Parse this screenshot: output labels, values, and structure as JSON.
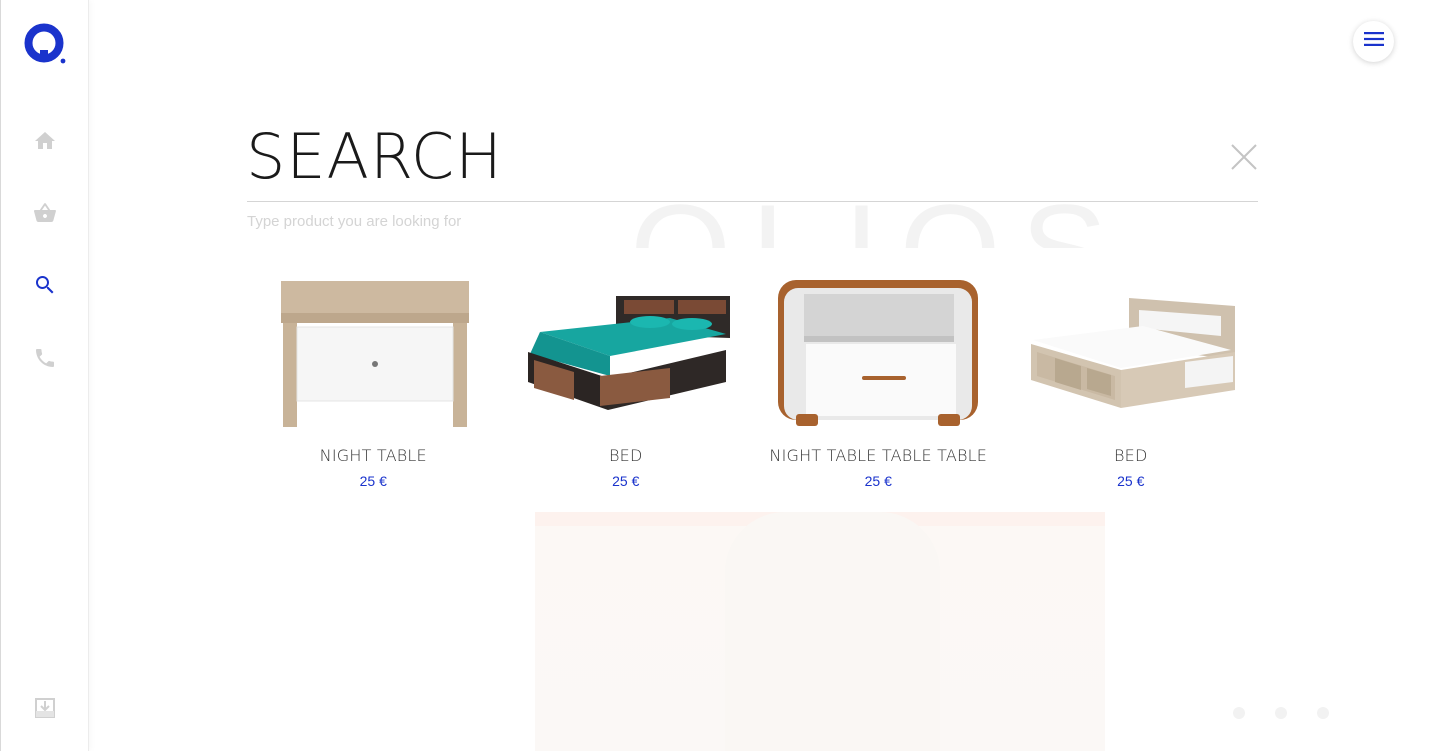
{
  "brand": {
    "accent": "#1a33cc",
    "logo_icon": "logo-ring-icon"
  },
  "sidebar": {
    "items": [
      {
        "name": "home",
        "icon": "home-icon",
        "active": false
      },
      {
        "name": "basket",
        "icon": "basket-icon",
        "active": false
      },
      {
        "name": "search",
        "icon": "search-icon",
        "active": true
      },
      {
        "name": "phone",
        "icon": "phone-icon",
        "active": false
      }
    ],
    "footer_icon": "download-icon"
  },
  "header": {
    "menu_icon": "hamburger-icon"
  },
  "search": {
    "title": "SEARCH",
    "placeholder": "Type product you are looking for",
    "value": "",
    "close_icon": "close-icon"
  },
  "background": {
    "word": "OLIOS"
  },
  "results": [
    {
      "name": "NIGHT TABLE",
      "price": "25 €",
      "image": "night-table-image"
    },
    {
      "name": "BED",
      "price": "25 €",
      "image": "bed-image"
    },
    {
      "name": "NIGHT TABLE TABLE TABLE",
      "price": "25 €",
      "image": "night-table-image"
    },
    {
      "name": "BED",
      "price": "25 €",
      "image": "bed-image"
    }
  ]
}
